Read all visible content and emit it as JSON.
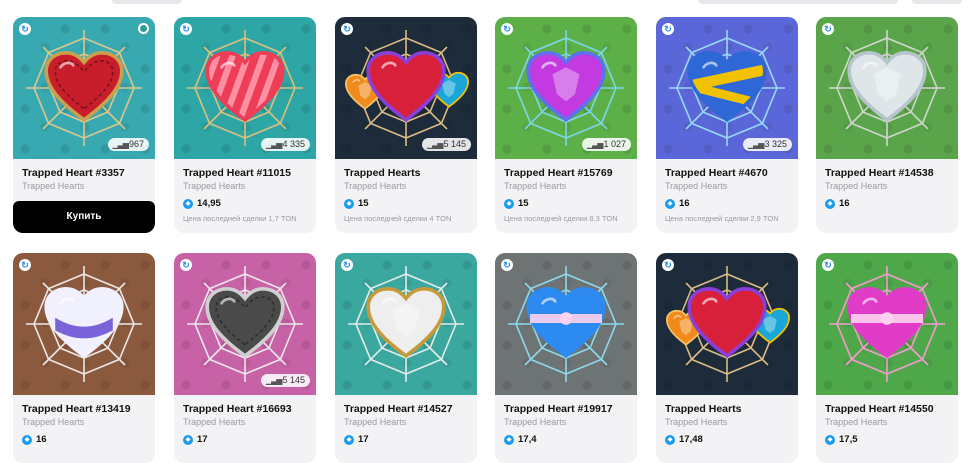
{
  "colors": {
    "ton_blue": "#1a9bf0",
    "verified_blue": "#2a8be6",
    "buy_button": "#000000"
  },
  "row1": [
    {
      "title": "Trapped Heart #3357",
      "collection": "Trapped Hearts",
      "count": "967",
      "buy_label": "Купить",
      "bg": "#38a9b0",
      "heart": "#c81e2c",
      "rim": "#c9a04c",
      "web": "#e8c98a",
      "style": "stitched",
      "selected_badge": true
    },
    {
      "title": "Trapped Heart #11015",
      "collection": "Trapped Hearts",
      "count": "4 335",
      "price": "14,95",
      "last_deal": "Цена последней сделки 1,7 TON",
      "bg": "#2fa6a6",
      "heart": "#ee3d57",
      "rim": "#ee3d57",
      "web": "#e6c27a",
      "style": "striped"
    },
    {
      "title": "Trapped Hearts",
      "collection": "Trapped Hearts",
      "count": "5 145",
      "price": "15",
      "last_deal": "Цена последней сделки 4 TON",
      "bg": "#1d2b3a",
      "heart": "#d9203a",
      "rim": "#8b3fd9",
      "web": "#e7c58a",
      "style": "trio"
    },
    {
      "title": "Trapped Heart #15769",
      "collection": "Trapped Hearts",
      "count": "1 027",
      "price": "15",
      "last_deal": "Цена последней сделки 8,3 TON",
      "bg": "#5cb047",
      "heart": "#c23ae0",
      "rim": "#5f6ff0",
      "web": "#7fd8f5",
      "style": "gem"
    },
    {
      "title": "Trapped Heart #4670",
      "collection": "Trapped Hearts",
      "count": "3 325",
      "price": "16",
      "last_deal": "Цена последней сделки 2,9 TON",
      "bg": "#5b67d8",
      "heart": "#2e68d6",
      "rim": "#2e68d6",
      "web": "#9ae2f5",
      "style": "taped"
    },
    {
      "title": "Trapped Heart #14538",
      "collection": "Trapped Hearts",
      "price": "16",
      "bg": "#5aa54a",
      "heart": "#dfe6ea",
      "rim": "#b8c4cb",
      "web": "#d8d8d8",
      "style": "crystal"
    }
  ],
  "row2": [
    {
      "title": "Trapped Heart #13419",
      "collection": "Trapped Hearts",
      "price": "16",
      "bg": "#8b5a3e",
      "heart": "#7a63d8",
      "rim": "#f1f0ff",
      "web": "#f2f2f2",
      "style": "pillow"
    },
    {
      "title": "Trapped Heart #16693",
      "collection": "Trapped Hearts",
      "count": "5 145",
      "price": "17",
      "bg": "#c862a6",
      "heart": "#4a4a4a",
      "rim": "#d0d0d0",
      "web": "#f0f0f0",
      "style": "stitched"
    },
    {
      "title": "Trapped Heart #14527",
      "collection": "Trapped Hearts",
      "price": "17",
      "bg": "#3aa89f",
      "heart": "#eeeeee",
      "rim": "#c69a3a",
      "web": "#f0f0f0",
      "style": "crystal"
    },
    {
      "title": "Trapped Heart #19917",
      "collection": "Trapped Hearts",
      "price": "17,4",
      "bg": "#6e7474",
      "heart": "#2d8af0",
      "rim": "#2d8af0",
      "web": "#8fe0f5",
      "style": "ribbon"
    },
    {
      "title": "Trapped Hearts",
      "collection": "Trapped Hearts",
      "price": "17,48",
      "bg": "#1d2b3a",
      "heart": "#d9203a",
      "rim": "#8b3fd9",
      "web": "#e7c58a",
      "style": "trio"
    },
    {
      "title": "Trapped Heart #14550",
      "collection": "Trapped Hearts",
      "price": "17,5",
      "bg": "#4ea84a",
      "heart": "#e03cc8",
      "rim": "#e03cc8",
      "web": "#ff9ad6",
      "style": "ribbon"
    }
  ]
}
